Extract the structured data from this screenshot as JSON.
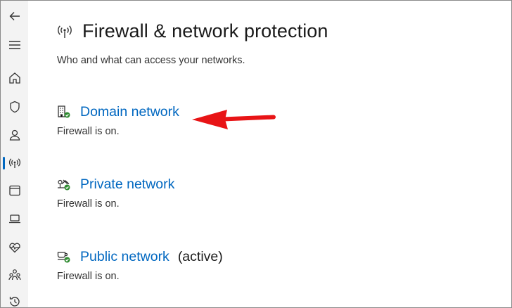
{
  "sidebar": {
    "items": [
      {
        "name": "back-icon"
      },
      {
        "name": "menu-icon"
      },
      {
        "name": "home-icon"
      },
      {
        "name": "shield-icon"
      },
      {
        "name": "person-icon"
      },
      {
        "name": "network-icon",
        "active": true
      },
      {
        "name": "app-browser-icon"
      },
      {
        "name": "laptop-icon"
      },
      {
        "name": "heart-pulse-icon"
      },
      {
        "name": "family-icon"
      },
      {
        "name": "history-icon"
      }
    ],
    "accent": "#0067c0"
  },
  "header": {
    "title": "Firewall & network protection",
    "subtitle": "Who and what can access your networks."
  },
  "networks": [
    {
      "label": "Domain network",
      "status": "Firewall is on.",
      "active_label": ""
    },
    {
      "label": "Private network",
      "status": "Firewall is on.",
      "active_label": ""
    },
    {
      "label": "Public network",
      "status": "Firewall is on.",
      "active_label": "(active)"
    }
  ],
  "colors": {
    "link": "#0067c0",
    "ok_badge": "#2e8b30",
    "annotation_arrow": "#e81416"
  }
}
